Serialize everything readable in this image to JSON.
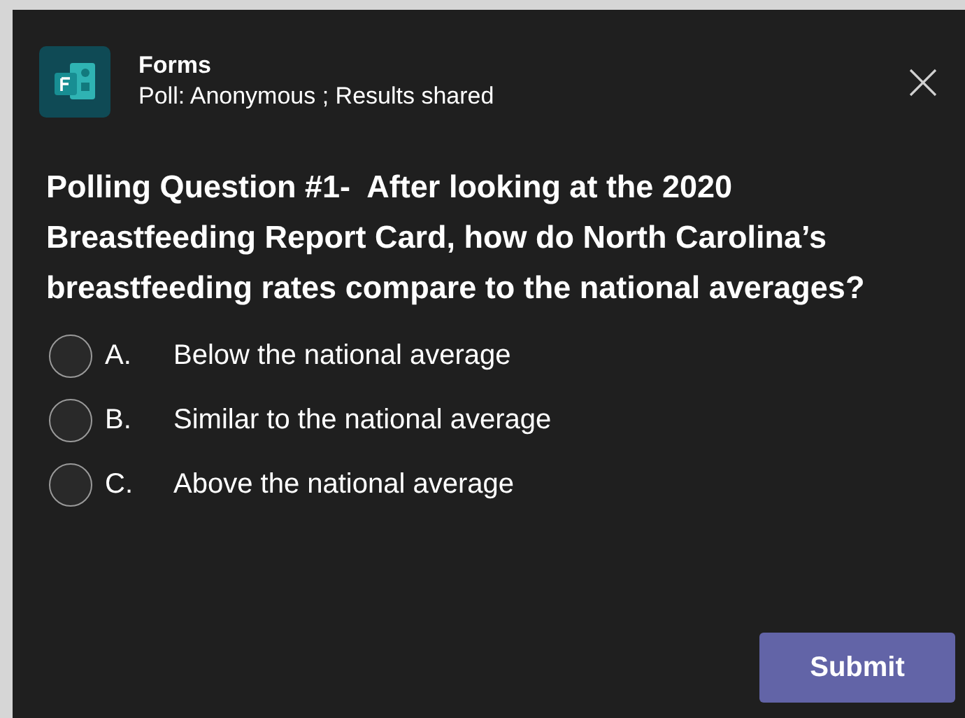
{
  "app": {
    "name": "Forms",
    "subtitle": "Poll: Anonymous ; Results shared"
  },
  "question": "Polling Question #1-  After looking at the 2020 Breastfeeding Report Card, how do North Carolina’s breastfeeding rates compare to the national averages?",
  "options": [
    {
      "letter": "A.",
      "label": "Below the national average",
      "selected": false
    },
    {
      "letter": "B.",
      "label": "Similar to the national average",
      "selected": false
    },
    {
      "letter": "C.",
      "label": "Above the national average",
      "selected": false
    }
  ],
  "submit": "Submit"
}
